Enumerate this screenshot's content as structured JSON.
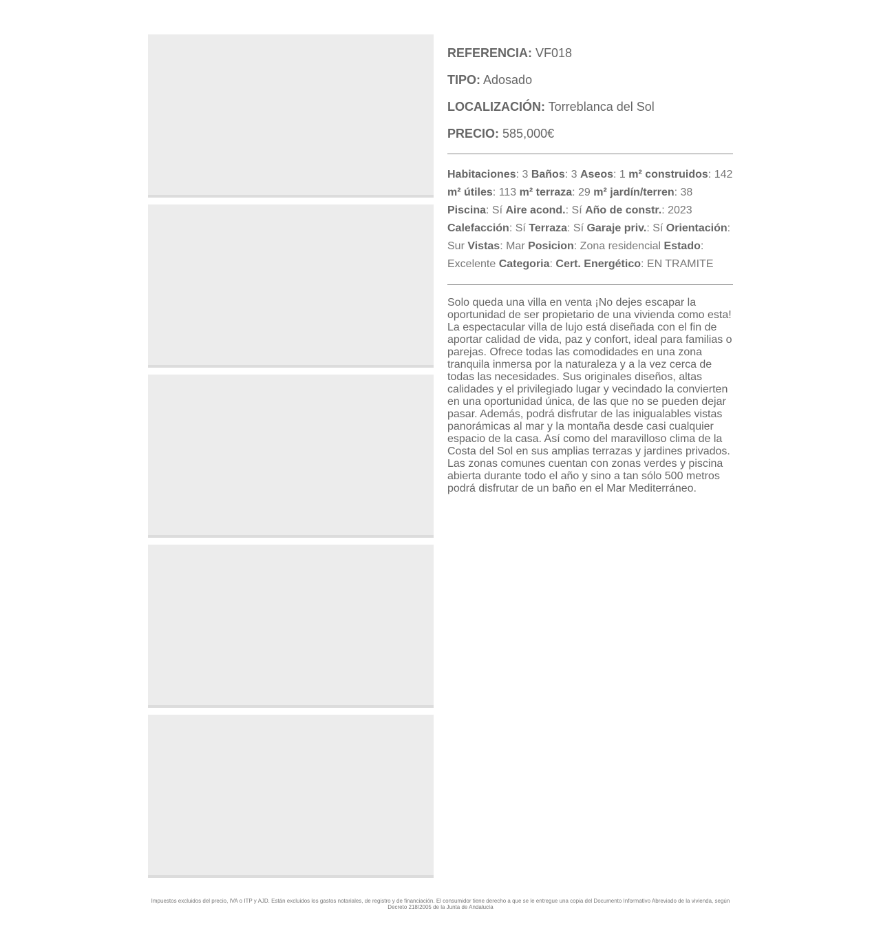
{
  "property": {
    "reference_label": "REFERENCIA:",
    "reference_value": "VF018",
    "type_label": "TIPO:",
    "type_value": "Adosado",
    "location_label": "LOCALIZACIÓN:",
    "location_value": "Torreblanca del Sol",
    "price_label": "PRECIO:",
    "price_value": "585,000€"
  },
  "features": [
    {
      "label": "Habitaciones",
      "value": ": 3 "
    },
    {
      "label": "Baños",
      "value": ": 3 "
    },
    {
      "label": "Aseos",
      "value": ": 1 "
    },
    {
      "label": "m² construidos",
      "value": ": 142 "
    },
    {
      "label": "m² útiles",
      "value": ": 113 "
    },
    {
      "label": "m² terraza",
      "value": ": 29 "
    },
    {
      "label": "m² jardín/terren",
      "value": ": 38 "
    },
    {
      "label": "Piscina",
      "value": ": Sí "
    },
    {
      "label": "Aire acond.",
      "value": ": Sí "
    },
    {
      "label": "Año de constr.",
      "value": ": 2023 "
    },
    {
      "label": "Calefacción",
      "value": ": Sí "
    },
    {
      "label": "Terraza",
      "value": ": Sí "
    },
    {
      "label": "Garaje priv.",
      "value": ": Sí "
    },
    {
      "label": "Orientación",
      "value": ": Sur "
    },
    {
      "label": "Vistas",
      "value": ": Mar "
    },
    {
      "label": "Posicion",
      "value": ": Zona residencial "
    },
    {
      "label": "Estado",
      "value": ": Excelente "
    },
    {
      "label": "Categoria",
      "value": ": "
    },
    {
      "label": "Cert. Energético",
      "value": ": EN TRAMITE"
    }
  ],
  "description": "Solo queda una villa en venta ¡No dejes escapar la oportunidad de ser propietario de una vivienda como esta! La espectacular villa de lujo está diseñada con el fin de aportar calidad de vida, paz y confort, ideal para familias o parejas. Ofrece todas las comodidades en una zona tranquila inmersa por la naturaleza y a la vez cerca de todas las necesidades. Sus originales diseños, altas calidades y el privilegiado lugar y vecindado la convierten en una oportunidad única, de las que no se pueden dejar pasar. Además, podrá disfrutar de las inigualables vistas panorámicas al mar y la montaña desde casi cualquier espacio de la casa. Así como del maravilloso clima de la Costa del Sol en sus amplias terrazas y jardines privados. Las zonas comunes cuentan con zonas verdes y piscina abierta durante todo el año y sino a tan sólo 500 metros podrá disfrutar de un baño en el Mar Mediterráneo.",
  "disclaimer": "Impuestos excluidos del precio, IVA o ITP y AJD. Están excluidos los gastos notariales, de registro y de financiación. El consumidor tiene derecho a que se le entregue una copia del Documento Informativo Abreviado de la vivienda, según Decreto 218/2005 de la Junta de Andalucía"
}
